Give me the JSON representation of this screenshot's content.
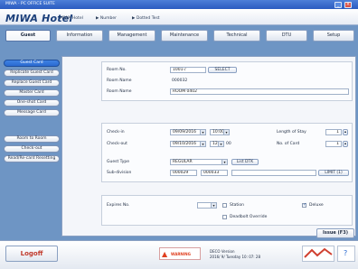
{
  "window": {
    "title": "MIWA - PC OFFICE SUITE"
  },
  "header": {
    "logo": "MIWA Hotel",
    "menu": [
      "MIWA Hotel",
      "▶ Number",
      "▶ Dotted Test"
    ]
  },
  "tabs": [
    {
      "label": "Guest",
      "active": true
    },
    {
      "label": "Information"
    },
    {
      "label": "Management"
    },
    {
      "label": "Maintenance"
    },
    {
      "label": "Technical"
    },
    {
      "label": "DTU"
    },
    {
      "label": "Setup"
    }
  ],
  "sidebar": {
    "items": [
      {
        "label": "Guest Card",
        "selected": true
      },
      {
        "label": "Replicate Guest Card"
      },
      {
        "label": "Replace Guest Card"
      },
      {
        "label": "Master Card"
      },
      {
        "label": "One-shot Card"
      },
      {
        "label": "Message Card"
      },
      {
        "label": "Room to Room"
      },
      {
        "label": "Check-out"
      },
      {
        "label": "Read/Re-card Resetting"
      }
    ]
  },
  "form": {
    "room_no_label": "Room No.",
    "room_no_value": "1001-/",
    "room_no_btn": "SELECT",
    "room_name_label": "Room Name",
    "room_name_value": "000032",
    "room_name2_label": "Room Name",
    "room_name2_value": "ROOM 0402",
    "checkin_label": "Check-in",
    "checkin_date": "09/09/2016",
    "checkin_time": "10:00",
    "length_label": "Length of Stay",
    "length_value": "1",
    "checkout_label": "Check-out",
    "checkout_date": "09/10/2016",
    "checkout_time": "12",
    "checkout_unit": "00",
    "cards_label": "No. of Card",
    "cards_value": "1",
    "guest_type_label": "Guest Type",
    "guest_type_value": "REGULAR",
    "guest_type_btn": "List DTK",
    "subgroup_label": "Sub-division",
    "subgroup_v1": "000029",
    "subgroup_v2": "000033",
    "subgroup_btn": "LIMIT (1)",
    "expires_label": "Expires No.",
    "opt1": "Station",
    "opt2": "Deadbolt Override",
    "opt3": "Deluxe",
    "issue_btn": "Issue (F3)"
  },
  "bottom": {
    "logoff": "Logoff",
    "warn": "WARNING",
    "status_line1": "DECO  Version",
    "status_line2": "2016/ 9/ Tuesday 10: 07: 28",
    "brand": "MIWA"
  },
  "colors": {
    "accent": "#2a6ad0",
    "frame": "#6e95c4",
    "warn": "#e04020"
  }
}
